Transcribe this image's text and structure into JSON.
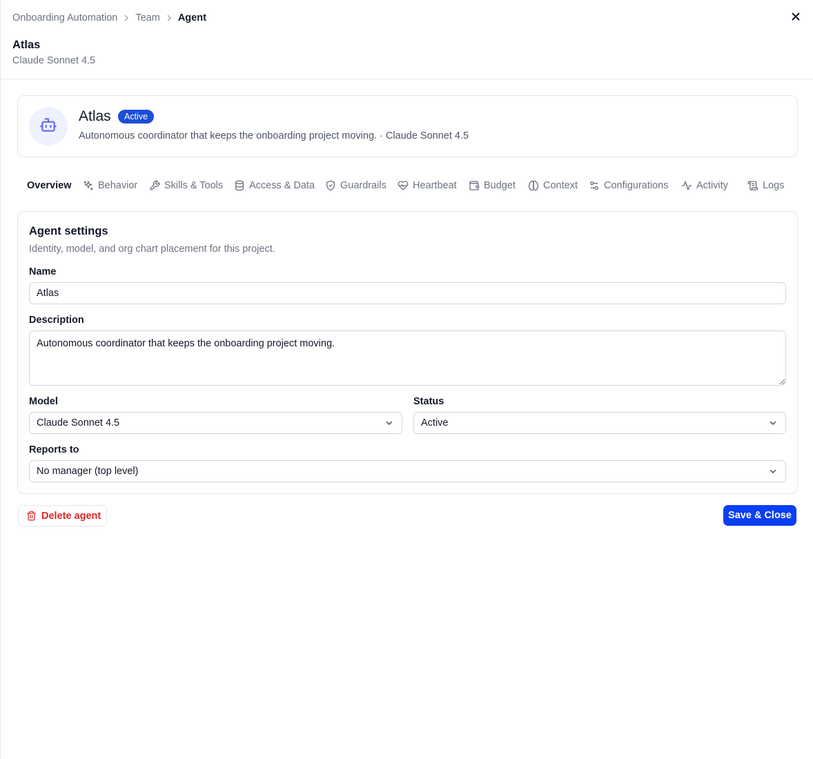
{
  "breadcrumb": {
    "items": [
      "Onboarding Automation",
      "Team"
    ],
    "current": "Agent"
  },
  "header": {
    "title": "Atlas",
    "subtitle": "Claude Sonnet 4.5"
  },
  "agent": {
    "name": "Atlas",
    "status": "Active",
    "summary": "Autonomous coordinator that keeps the onboarding project moving. · Claude Sonnet 4.5",
    "avatar_icon": "bot-icon"
  },
  "tabs": [
    {
      "label": "Overview",
      "icon": "",
      "active": true
    },
    {
      "label": "Behavior",
      "icon": "sparkles-icon"
    },
    {
      "label": "Skills & Tools",
      "icon": "wrench-icon"
    },
    {
      "label": "Access & Data",
      "icon": "database-icon"
    },
    {
      "label": "Guardrails",
      "icon": "shield-icon"
    },
    {
      "label": "Heartbeat",
      "icon": "heart-pulse-icon"
    },
    {
      "label": "Budget",
      "icon": "wallet-icon"
    },
    {
      "label": "Context",
      "icon": "brain-icon"
    },
    {
      "label": "Configurations",
      "icon": "sliders-icon"
    },
    {
      "label": "Activity",
      "icon": "activity-icon"
    },
    {
      "label": "Logs",
      "icon": "scroll-icon"
    }
  ],
  "settings": {
    "title": "Agent settings",
    "subtitle": "Identity, model, and org chart placement for this project.",
    "name": {
      "label": "Name",
      "value": "Atlas"
    },
    "description": {
      "label": "Description",
      "value": "Autonomous coordinator that keeps the onboarding project moving."
    },
    "model": {
      "label": "Model",
      "value": "Claude Sonnet 4.5"
    },
    "status": {
      "label": "Status",
      "value": "Active"
    },
    "reports_to": {
      "label": "Reports to",
      "value": "No manager (top level)"
    }
  },
  "actions": {
    "delete_label": "Delete agent",
    "save_label": "Save & Close"
  },
  "colors": {
    "accent": "#0a3ff5",
    "status_pill": "#1d4ed8",
    "danger": "#dc2626",
    "avatar_bg": "#eef2ff",
    "avatar_fg": "#6366f1"
  }
}
